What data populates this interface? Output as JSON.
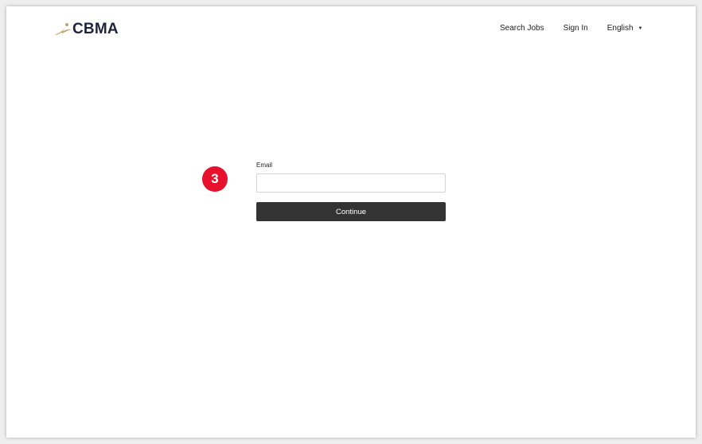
{
  "brand": {
    "name": "CBMA",
    "mark_icon": "cbma-swoosh-logo-icon",
    "mark_color": "#c4a46c",
    "text_color": "#1f2340"
  },
  "nav": {
    "search_jobs": "Search Jobs",
    "sign_in": "Sign In",
    "language": "English",
    "language_icon": "caret-down-icon"
  },
  "step": {
    "number": "3",
    "color": "#e8112d"
  },
  "form": {
    "email_label": "Email",
    "email_value": "",
    "email_placeholder": "",
    "continue_label": "Continue",
    "button_color": "#333333"
  }
}
